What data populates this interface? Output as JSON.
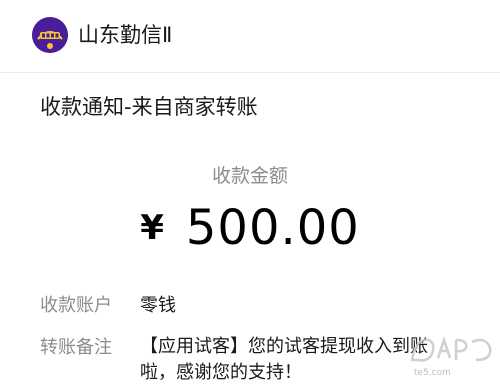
{
  "sender": {
    "name": "山东勤信Ⅱ",
    "avatar_icon": "app-logo-icon",
    "avatar_color": "#5b28b5"
  },
  "notice": {
    "title": "收款通知-来自商家转账"
  },
  "amount": {
    "label": "收款金额",
    "currency": "¥",
    "value": "500.00"
  },
  "details": [
    {
      "label": "收款账户",
      "value": "零钱"
    },
    {
      "label": "转账备注",
      "value_lines": [
        "【应用试客】您的试客提现收入到账",
        "啦，感谢您的支持！"
      ]
    }
  ],
  "watermark": {
    "text": "te5.com"
  }
}
